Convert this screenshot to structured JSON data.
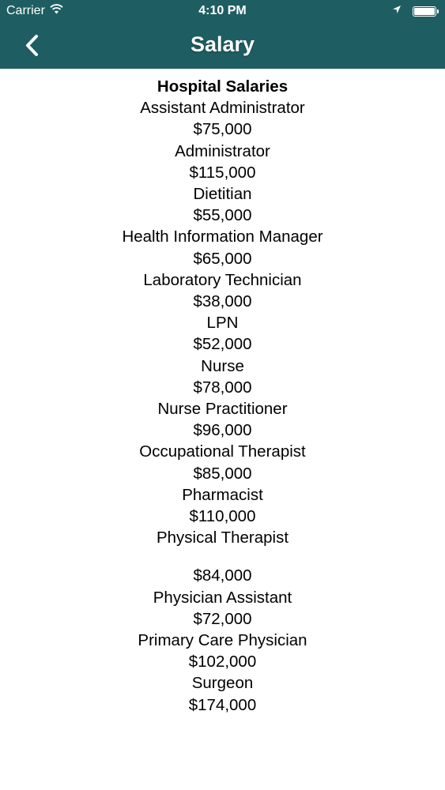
{
  "status_bar": {
    "carrier": "Carrier",
    "time": "4:10 PM",
    "battery_level": 1.0
  },
  "nav": {
    "title": "Salary",
    "back_icon": "chevron-left-icon"
  },
  "content": {
    "title": "Hospital Salaries",
    "items": [
      {
        "role": "Assistant Administrator",
        "salary": "$75,000"
      },
      {
        "role": "Administrator",
        "salary": "$115,000"
      },
      {
        "role": "Dietitian",
        "salary": "$55,000"
      },
      {
        "role": "Health Information Manager",
        "salary": "$65,000"
      },
      {
        "role": "Laboratory Technician",
        "salary": "$38,000"
      },
      {
        "role": "LPN",
        "salary": "$52,000"
      },
      {
        "role": "Nurse",
        "salary": "$78,000"
      },
      {
        "role": "Nurse Practitioner",
        "salary": "$96,000"
      },
      {
        "role": "Occupational Therapist",
        "salary": "$85,000"
      },
      {
        "role": "Pharmacist",
        "salary": "$110,000"
      },
      {
        "role": "Physical Therapist",
        "salary": "$84,000"
      },
      {
        "role": "Physician Assistant",
        "salary": "$72,000"
      },
      {
        "role": "Primary Care Physician",
        "salary": "$102,000"
      },
      {
        "role": "Surgeon",
        "salary": "$174,000"
      }
    ]
  },
  "colors": {
    "header_bg": "#1e5e62",
    "header_text": "#ffffff",
    "body_text": "#000000"
  }
}
